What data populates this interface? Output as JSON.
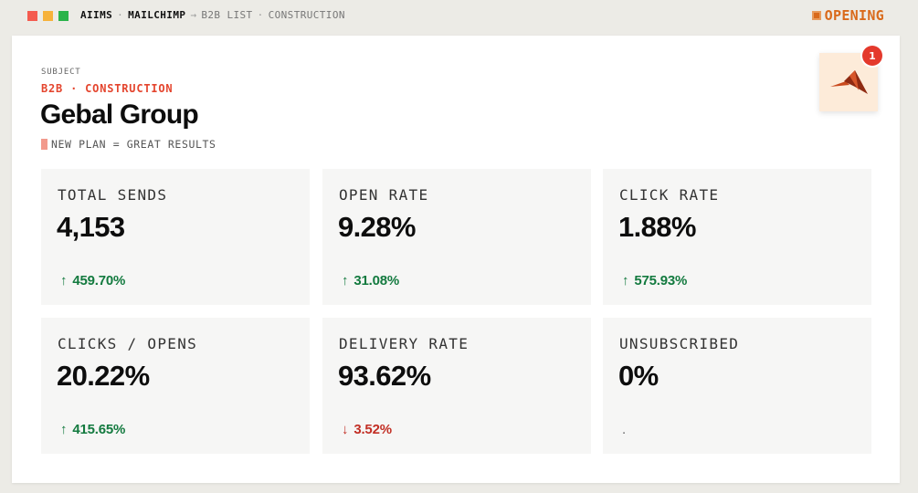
{
  "window": {
    "controls": [
      {
        "name": "close",
        "color": "#f45b4f"
      },
      {
        "name": "minimize",
        "color": "#f6b23b"
      },
      {
        "name": "maximize",
        "color": "#2bb34a"
      }
    ]
  },
  "breadcrumb": {
    "app": "AIIMS",
    "sep1": "·",
    "service": "MAILCHIMP",
    "arrow": "→",
    "list": "B2B LIST",
    "sep2": "·",
    "segment": "CONSTRUCTION"
  },
  "status": {
    "label": "OPENING",
    "color": "#d96a1b"
  },
  "header": {
    "subject_label": "SUBJECT",
    "category": "B2B · CONSTRUCTION",
    "company": "Gebal Group",
    "tagline": "NEW PLAN = GREAT RESULTS"
  },
  "logo": {
    "icon": "mountain-logo-icon",
    "notification_count": "1",
    "bg_color": "#fdebd9",
    "badge_color": "#e4392c"
  },
  "metrics": [
    {
      "label": "TOTAL SENDS",
      "value": "4,153",
      "delta": "459.70%",
      "direction": "up",
      "arrow": "↑"
    },
    {
      "label": "OPEN RATE",
      "value": "9.28%",
      "delta": "31.08%",
      "direction": "up",
      "arrow": "↑"
    },
    {
      "label": "CLICK RATE",
      "value": "1.88%",
      "delta": "575.93%",
      "direction": "up",
      "arrow": "↑"
    },
    {
      "label": "CLICKS / OPENS",
      "value": "20.22%",
      "delta": "415.65%",
      "direction": "up",
      "arrow": "↑"
    },
    {
      "label": "DELIVERY RATE",
      "value": "93.62%",
      "delta": "3.52%",
      "direction": "down",
      "arrow": "↓"
    },
    {
      "label": "UNSUBSCRIBED",
      "value": "0%",
      "delta": ".",
      "direction": "none",
      "arrow": ""
    }
  ],
  "colors": {
    "up": "#137a3f",
    "down": "#c22f25",
    "accent": "#e4452e"
  }
}
